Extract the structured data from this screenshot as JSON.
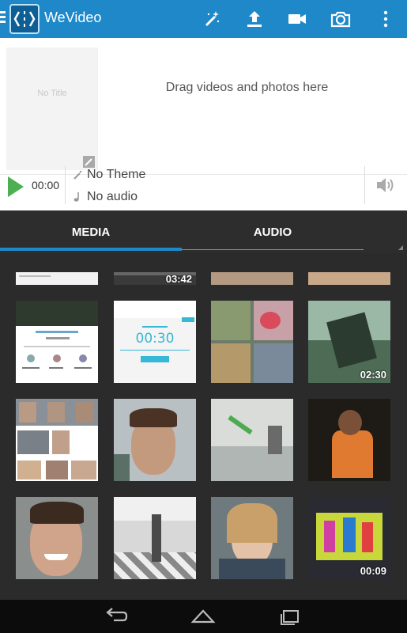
{
  "app": {
    "title": "WeVideo"
  },
  "actionbar": {
    "icons": [
      "magic-wand-icon",
      "upload-icon",
      "video-camera-icon",
      "camera-icon",
      "overflow-menu-icon"
    ]
  },
  "editor": {
    "thumbnail_placeholder": "No Title",
    "drag_hint": "Drag videos and photos here",
    "time": "00:00",
    "theme": "No Theme",
    "audio": "No audio"
  },
  "tabs": {
    "media": "MEDIA",
    "audio": "AUDIO",
    "active": "media"
  },
  "media_items": [
    {
      "kind": "screenshot",
      "duration": ""
    },
    {
      "kind": "video",
      "duration": "03:42"
    },
    {
      "kind": "photo",
      "duration": ""
    },
    {
      "kind": "photo",
      "duration": ""
    },
    {
      "kind": "screenshot-app",
      "duration": ""
    },
    {
      "kind": "screenshot-timer",
      "duration": ""
    },
    {
      "kind": "screenshot-collage",
      "duration": ""
    },
    {
      "kind": "video",
      "duration": "02:30"
    },
    {
      "kind": "screenshot-faces",
      "duration": ""
    },
    {
      "kind": "photo-selfie",
      "duration": ""
    },
    {
      "kind": "photo-office",
      "duration": ""
    },
    {
      "kind": "photo-man-orange",
      "duration": ""
    },
    {
      "kind": "photo-man-smile",
      "duration": ""
    },
    {
      "kind": "photo-office-room",
      "duration": ""
    },
    {
      "kind": "photo-woman",
      "duration": ""
    },
    {
      "kind": "video-game",
      "duration": "00:09"
    }
  ],
  "colors": {
    "accent": "#1e88c9",
    "play": "#4caf50",
    "background": "#2b2b2b"
  }
}
